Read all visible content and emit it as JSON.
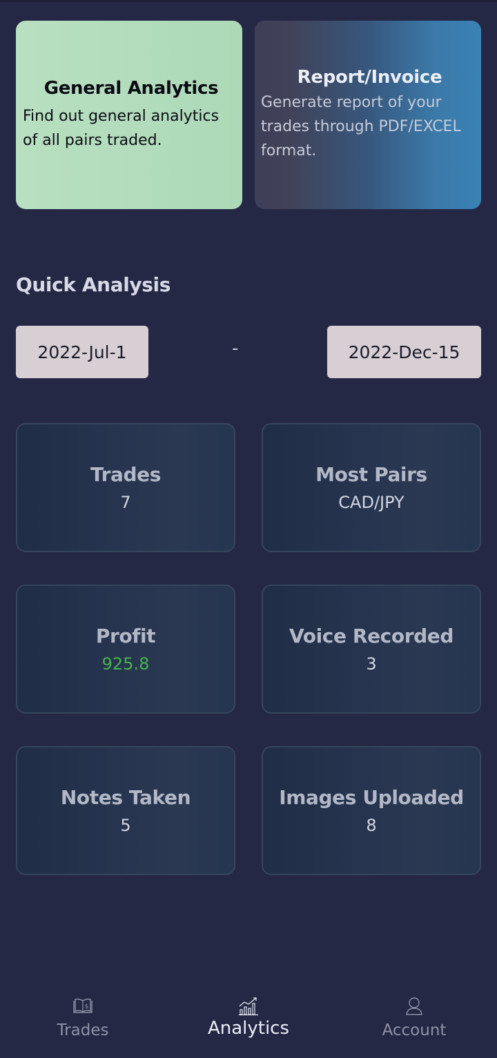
{
  "cards": {
    "general": {
      "title": "General Analytics",
      "desc_line1": "Find out general analytics",
      "desc_line2": "of all pairs traded."
    },
    "report": {
      "title": "Report/Invoice",
      "desc_line1": "Generate report of your",
      "desc_line2": "trades through PDF/EXCEL",
      "desc_line3": "format."
    }
  },
  "quick_analysis": {
    "title": "Quick Analysis",
    "start_date": "2022-Jul-1",
    "separator": "-",
    "end_date": "2022-Dec-15"
  },
  "stats": {
    "trades": {
      "label": "Trades",
      "value": "7"
    },
    "most_pairs": {
      "label": "Most Pairs",
      "value": "CAD/JPY"
    },
    "profit": {
      "label": "Profit",
      "value": "925.8"
    },
    "voice": {
      "label": "Voice Recorded",
      "value": "3"
    },
    "notes": {
      "label": "Notes Taken",
      "value": "5"
    },
    "images": {
      "label": "Images Uploaded",
      "value": "8"
    }
  },
  "nav": {
    "trades": {
      "label": "Trades",
      "icon": "book-dollar-icon"
    },
    "analytics": {
      "label": "Analytics",
      "icon": "bar-chart-icon"
    },
    "account": {
      "label": "Account",
      "icon": "user-icon"
    }
  },
  "colors": {
    "background": "#252845",
    "general_card": "#b2dcbc",
    "report_card_start": "#414258",
    "report_card_end": "#3a82b5",
    "profit_positive": "#46b44c",
    "date_button": "#d7cfd4"
  }
}
